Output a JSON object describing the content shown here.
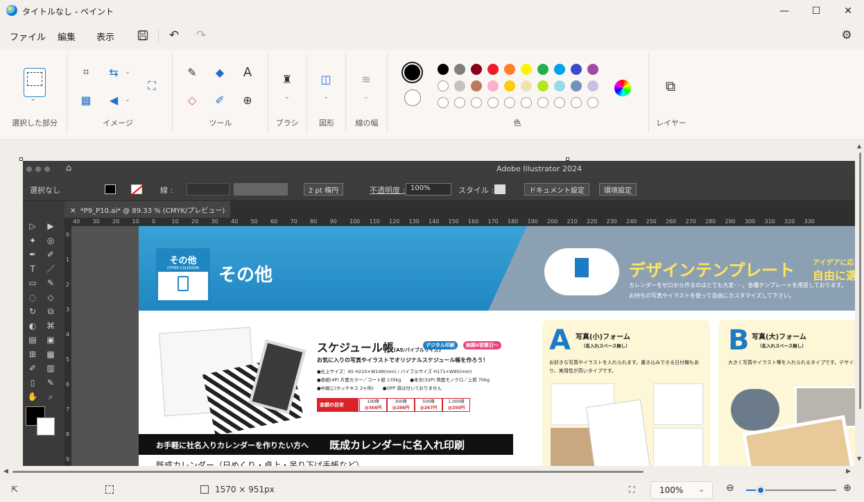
{
  "window": {
    "title": "タイトルなし - ペイント",
    "minimize": "—",
    "maximize": "☐",
    "close": "✕"
  },
  "menu": {
    "file": "ファイル",
    "edit": "編集",
    "view": "表示"
  },
  "toolbar": {
    "save_icon": "save-icon",
    "undo_icon": "undo-icon",
    "redo_icon": "redo-icon",
    "settings_icon": "gear-icon"
  },
  "ribbon": {
    "selection_label": "選択した部分",
    "image_label": "イメージ",
    "tools_label": "ツール",
    "brush_label": "ブラシ",
    "shapes_label": "図形",
    "line_width_label": "線の幅",
    "colors_label": "色",
    "layers_label": "レイヤー",
    "text_tool": "A",
    "color1": "#000000",
    "color2": "#ffffff",
    "palette_row1": [
      "#000000",
      "#7f7f7f",
      "#880015",
      "#ed1c24",
      "#ff7f27",
      "#fff200",
      "#22b14c",
      "#00a2e8",
      "#3f48cc",
      "#a349a4"
    ],
    "palette_row2": [
      "#ffffff",
      "#c3c3c3",
      "#b97a57",
      "#ffaec9",
      "#ffc90e",
      "#efe4b0",
      "#b5e61d",
      "#99d9ea",
      "#7092be",
      "#c8bfe7"
    ]
  },
  "illustrator": {
    "app_title": "Adobe Illustrator 2024",
    "no_selection": "選択なし",
    "stroke_label": "線 :",
    "stroke_size": "2 pt 楕円",
    "opacity_label": "不透明度 :",
    "opacity_value": "100%",
    "style_label": "スタイル :",
    "doc_settings": "ドキュメント設定",
    "preferences": "環境設定",
    "tab_close": "✕",
    "tab_label": "*P9_P10.ai* @ 89.33 % (CMYK/プレビュー)",
    "ruler_ticks": [
      "40",
      "30",
      "20",
      "10",
      "0",
      "10",
      "20",
      "30",
      "40",
      "50",
      "60",
      "70",
      "80",
      "90",
      "100",
      "110",
      "120",
      "130",
      "140",
      "150",
      "160",
      "170",
      "180",
      "190",
      "200",
      "210",
      "220",
      "230",
      "240",
      "250",
      "260",
      "270",
      "280",
      "290",
      "300",
      "310",
      "320",
      "330"
    ],
    "ruler_left": [
      "0",
      "1",
      "2",
      "3",
      "4",
      "5",
      "6",
      "7",
      "8",
      "9"
    ],
    "artwork": {
      "sonota_box_title": "その他",
      "sonota_box_sub": "OTHER CALENDAR",
      "sonota_heading": "その他",
      "design_template": "デザインテンプレート",
      "idea_small": "アイデアに応",
      "idea_big": "自由に選べ",
      "design_desc1": "カレンダーをゼロから作るのはとても大変･･･。各種テンプレートを用意しております。",
      "design_desc2": "お持ちの写真やイラストを使って自由にカスタマイズして下さい。",
      "schedule_title": "スケジュール帳",
      "schedule_size": "(A5/バイブルサイズ)",
      "digital_badge": "デジタル印刷",
      "days_badge": "納期4営業日〜",
      "schedule_catch": "お気に入りの写真やイラストでオリジナルスケジュール帳を作ろう！",
      "spec1": "●仕上サイズ：A5 H210×W148(mm) / バイブルサイズ H171×W95(mm)",
      "spec2": "●表紙(4P) 片面カラー／コート紙 135kg　　●本文(32P) 両面モノクロ／上質 70kg",
      "spec3": "●中綴じ(ホッチキス 2ヶ所)　　●OPP 袋は付いておりません",
      "price_label": "金額の目安",
      "price_qty": [
        "100冊",
        "300冊",
        "500冊",
        "1,000冊"
      ],
      "price_val": [
        "@366円",
        "@286円",
        "@267円",
        "@250円"
      ],
      "company_text": "お手軽に社名入りカレンダーを作りたい方へ",
      "existing_text": "既成カレンダーに名入れ印刷",
      "existing_sub": "既成カレンダー（日めくり・卓上・吊り下げ手帳など）",
      "a_letter": "A",
      "a_title": "写真(小)フォーム",
      "a_sub": "（名入れスペース無し）",
      "a_desc": "お好きな写真やイラストを入れられます。書き込みできる日付欄もあり、実用性が高いタイプです。",
      "b_letter": "B",
      "b_title": "写真(大)フォーム",
      "b_sub": "（名入れスペース無し）",
      "b_desc": "大きく写真やイラスト等を入れられるタイプです。デザイン性、オリジナル性の高いカレンダーテンプレートです。"
    }
  },
  "status": {
    "canvas_size": "1570 × 951px",
    "zoom": "100%"
  }
}
